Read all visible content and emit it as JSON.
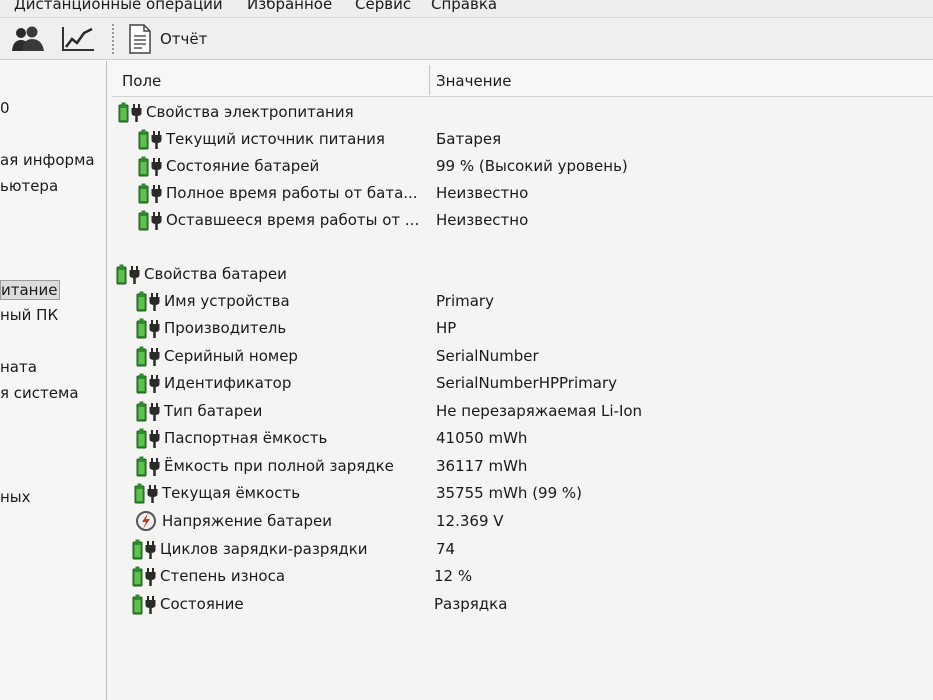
{
  "menu": [
    "Дистанционные операции",
    "Избранное",
    "Сервис",
    "Справка"
  ],
  "toolbar": {
    "report_label": "Отчёт"
  },
  "sidebar": [
    "0",
    "ая информа",
    "ьютера",
    "итание",
    "ный ПК",
    "ната",
    "я система",
    "ных"
  ],
  "columns": {
    "field": "Поле",
    "value": "Значение"
  },
  "sections": {
    "power": "Свойства электропитания",
    "battery": "Свойства батареи"
  },
  "power_rows": [
    {
      "field": "Текущий источник питания",
      "value": "Батарея"
    },
    {
      "field": "Состояние батарей",
      "value": "99 % (Высокий уровень)"
    },
    {
      "field": "Полное время работы от бата...",
      "value": "Неизвестно"
    },
    {
      "field": "Оставшееся время работы от ...",
      "value": "Неизвестно"
    }
  ],
  "battery_rows": [
    {
      "field": "Имя устройства",
      "value": "Primary"
    },
    {
      "field": "Производитель",
      "value": "HP"
    },
    {
      "field": "Серийный номер",
      "value": "SerialNumber"
    },
    {
      "field": "Идентификатор",
      "value": "SerialNumberHPPrimary"
    },
    {
      "field": "Тип батареи",
      "value": "Не перезаряжаемая Li-Ion"
    },
    {
      "field": "Паспортная ёмкость",
      "value": "41050 mWh"
    },
    {
      "field": "Ёмкость при полной зарядке",
      "value": "36117 mWh"
    },
    {
      "field": "Текущая ёмкость",
      "value": "35755 mWh  (99 %)"
    },
    {
      "field": "Напряжение батареи",
      "value": "12.369 V"
    },
    {
      "field": "Циклов зарядки-разрядки",
      "value": "74"
    },
    {
      "field": "Степень износа",
      "value": "12 %"
    },
    {
      "field": "Состояние",
      "value": "Разрядка"
    }
  ],
  "icons": {
    "battery": "battery-plug-icon",
    "voltage": "lightning-circle-icon",
    "users": "users-icon",
    "chart": "chart-line-icon",
    "report": "report-document-icon"
  },
  "colors": {
    "battery_green": "#2e8b2e",
    "plug_dark": "#2a2a2a"
  }
}
